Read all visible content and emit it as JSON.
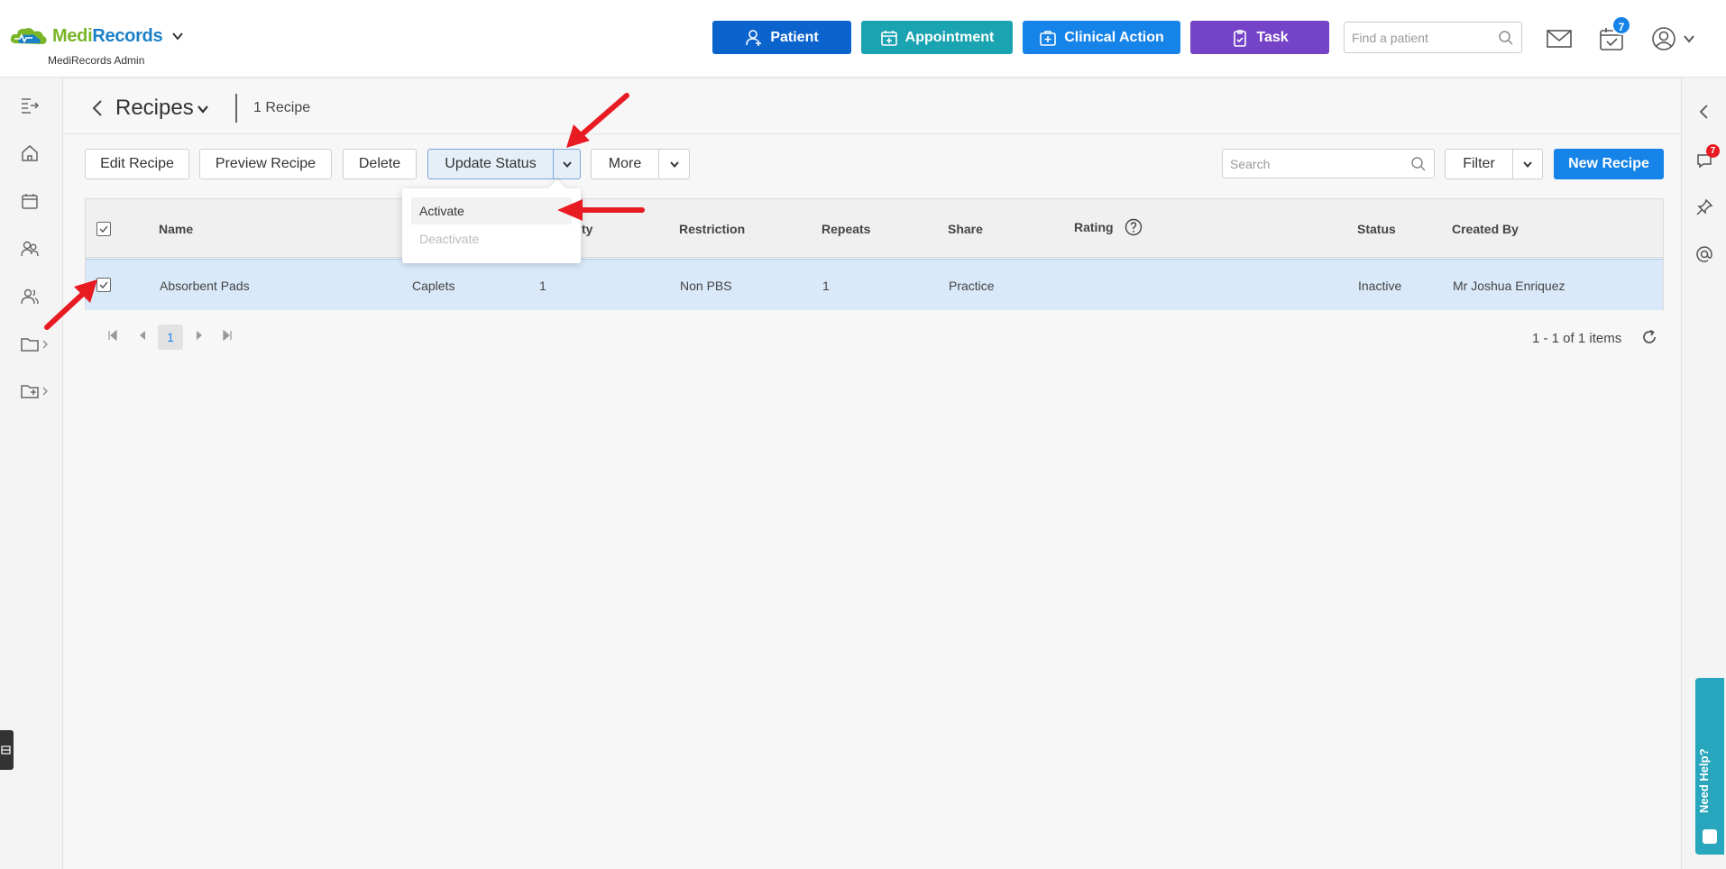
{
  "header": {
    "brand": {
      "medi": "Medi",
      "records": "Records"
    },
    "subtitle": "MediRecords Admin",
    "buttons": {
      "patient": "Patient",
      "appointment": "Appointment",
      "clinical": "Clinical Action",
      "task": "Task"
    },
    "find_placeholder": "Find a patient",
    "task_badge": "7"
  },
  "page": {
    "title": "Recipes",
    "count": "1 Recipe"
  },
  "toolbar": {
    "edit": "Edit Recipe",
    "preview": "Preview Recipe",
    "delete": "Delete",
    "update_status": "Update Status",
    "more": "More",
    "search_placeholder": "Search",
    "filter": "Filter",
    "new": "New Recipe"
  },
  "dropdown": {
    "activate": "Activate",
    "deactivate": "Deactivate"
  },
  "table": {
    "columns": {
      "name": "Name",
      "quantity_tail": "ty",
      "restriction": "Restriction",
      "repeats": "Repeats",
      "share": "Share",
      "rating": "Rating",
      "status": "Status",
      "created_by": "Created By"
    },
    "rows": [
      {
        "name": "Absorbent Pads",
        "form": "Caplets",
        "quantity": "1",
        "restriction": "Non PBS",
        "repeats": "1",
        "share": "Practice",
        "rating": "",
        "status": "Inactive",
        "created_by": "Mr Joshua Enriquez"
      }
    ]
  },
  "pager": {
    "page": "1",
    "info": "1 - 1 of 1 items"
  },
  "right_sidebar": {
    "chat_badge": "7"
  },
  "help": "Need Help?",
  "colors": {
    "patient": "#0b63ce",
    "appointment": "#1aa3b0",
    "clinical": "#1683e8",
    "task": "#7443c7",
    "primary": "#1683e8",
    "annotation_arrow": "#e81b23"
  }
}
